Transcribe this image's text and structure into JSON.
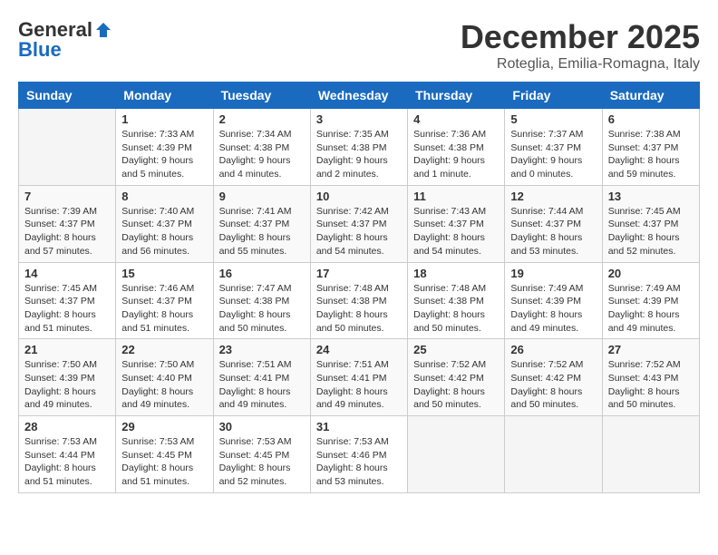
{
  "header": {
    "logo_general": "General",
    "logo_blue": "Blue",
    "month_title": "December 2025",
    "subtitle": "Roteglia, Emilia-Romagna, Italy"
  },
  "weekdays": [
    "Sunday",
    "Monday",
    "Tuesday",
    "Wednesday",
    "Thursday",
    "Friday",
    "Saturday"
  ],
  "weeks": [
    [
      {
        "day": "",
        "info": ""
      },
      {
        "day": "1",
        "info": "Sunrise: 7:33 AM\nSunset: 4:39 PM\nDaylight: 9 hours\nand 5 minutes."
      },
      {
        "day": "2",
        "info": "Sunrise: 7:34 AM\nSunset: 4:38 PM\nDaylight: 9 hours\nand 4 minutes."
      },
      {
        "day": "3",
        "info": "Sunrise: 7:35 AM\nSunset: 4:38 PM\nDaylight: 9 hours\nand 2 minutes."
      },
      {
        "day": "4",
        "info": "Sunrise: 7:36 AM\nSunset: 4:38 PM\nDaylight: 9 hours\nand 1 minute."
      },
      {
        "day": "5",
        "info": "Sunrise: 7:37 AM\nSunset: 4:37 PM\nDaylight: 9 hours\nand 0 minutes."
      },
      {
        "day": "6",
        "info": "Sunrise: 7:38 AM\nSunset: 4:37 PM\nDaylight: 8 hours\nand 59 minutes."
      }
    ],
    [
      {
        "day": "7",
        "info": "Sunrise: 7:39 AM\nSunset: 4:37 PM\nDaylight: 8 hours\nand 57 minutes."
      },
      {
        "day": "8",
        "info": "Sunrise: 7:40 AM\nSunset: 4:37 PM\nDaylight: 8 hours\nand 56 minutes."
      },
      {
        "day": "9",
        "info": "Sunrise: 7:41 AM\nSunset: 4:37 PM\nDaylight: 8 hours\nand 55 minutes."
      },
      {
        "day": "10",
        "info": "Sunrise: 7:42 AM\nSunset: 4:37 PM\nDaylight: 8 hours\nand 54 minutes."
      },
      {
        "day": "11",
        "info": "Sunrise: 7:43 AM\nSunset: 4:37 PM\nDaylight: 8 hours\nand 54 minutes."
      },
      {
        "day": "12",
        "info": "Sunrise: 7:44 AM\nSunset: 4:37 PM\nDaylight: 8 hours\nand 53 minutes."
      },
      {
        "day": "13",
        "info": "Sunrise: 7:45 AM\nSunset: 4:37 PM\nDaylight: 8 hours\nand 52 minutes."
      }
    ],
    [
      {
        "day": "14",
        "info": "Sunrise: 7:45 AM\nSunset: 4:37 PM\nDaylight: 8 hours\nand 51 minutes."
      },
      {
        "day": "15",
        "info": "Sunrise: 7:46 AM\nSunset: 4:37 PM\nDaylight: 8 hours\nand 51 minutes."
      },
      {
        "day": "16",
        "info": "Sunrise: 7:47 AM\nSunset: 4:38 PM\nDaylight: 8 hours\nand 50 minutes."
      },
      {
        "day": "17",
        "info": "Sunrise: 7:48 AM\nSunset: 4:38 PM\nDaylight: 8 hours\nand 50 minutes."
      },
      {
        "day": "18",
        "info": "Sunrise: 7:48 AM\nSunset: 4:38 PM\nDaylight: 8 hours\nand 50 minutes."
      },
      {
        "day": "19",
        "info": "Sunrise: 7:49 AM\nSunset: 4:39 PM\nDaylight: 8 hours\nand 49 minutes."
      },
      {
        "day": "20",
        "info": "Sunrise: 7:49 AM\nSunset: 4:39 PM\nDaylight: 8 hours\nand 49 minutes."
      }
    ],
    [
      {
        "day": "21",
        "info": "Sunrise: 7:50 AM\nSunset: 4:39 PM\nDaylight: 8 hours\nand 49 minutes."
      },
      {
        "day": "22",
        "info": "Sunrise: 7:50 AM\nSunset: 4:40 PM\nDaylight: 8 hours\nand 49 minutes."
      },
      {
        "day": "23",
        "info": "Sunrise: 7:51 AM\nSunset: 4:41 PM\nDaylight: 8 hours\nand 49 minutes."
      },
      {
        "day": "24",
        "info": "Sunrise: 7:51 AM\nSunset: 4:41 PM\nDaylight: 8 hours\nand 49 minutes."
      },
      {
        "day": "25",
        "info": "Sunrise: 7:52 AM\nSunset: 4:42 PM\nDaylight: 8 hours\nand 50 minutes."
      },
      {
        "day": "26",
        "info": "Sunrise: 7:52 AM\nSunset: 4:42 PM\nDaylight: 8 hours\nand 50 minutes."
      },
      {
        "day": "27",
        "info": "Sunrise: 7:52 AM\nSunset: 4:43 PM\nDaylight: 8 hours\nand 50 minutes."
      }
    ],
    [
      {
        "day": "28",
        "info": "Sunrise: 7:53 AM\nSunset: 4:44 PM\nDaylight: 8 hours\nand 51 minutes."
      },
      {
        "day": "29",
        "info": "Sunrise: 7:53 AM\nSunset: 4:45 PM\nDaylight: 8 hours\nand 51 minutes."
      },
      {
        "day": "30",
        "info": "Sunrise: 7:53 AM\nSunset: 4:45 PM\nDaylight: 8 hours\nand 52 minutes."
      },
      {
        "day": "31",
        "info": "Sunrise: 7:53 AM\nSunset: 4:46 PM\nDaylight: 8 hours\nand 53 minutes."
      },
      {
        "day": "",
        "info": ""
      },
      {
        "day": "",
        "info": ""
      },
      {
        "day": "",
        "info": ""
      }
    ]
  ]
}
